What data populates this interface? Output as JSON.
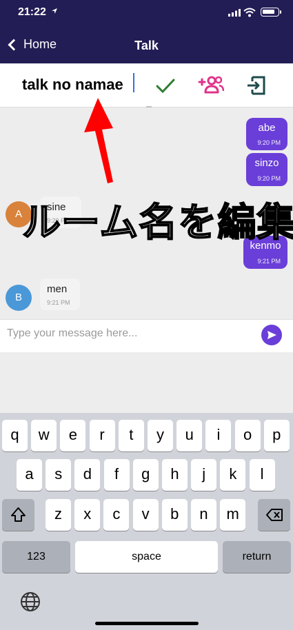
{
  "status_bar": {
    "time": "21:22"
  },
  "nav": {
    "back_label": "Home",
    "title": "Talk"
  },
  "room": {
    "name": "talk no namae"
  },
  "overlay": {
    "annotation": "ルーム名を編集"
  },
  "messages": [
    {
      "direction": "out",
      "text": "abe",
      "time": "9:20 PM"
    },
    {
      "direction": "out",
      "text": "sinzo",
      "time": "9:20 PM"
    },
    {
      "direction": "in",
      "avatar": "A",
      "text": "sine",
      "time": "9:20 PM",
      "avatar_color": "#d9823b"
    },
    {
      "direction": "out",
      "text": "kenmo",
      "time": "9:21 PM"
    },
    {
      "direction": "in",
      "avatar": "B",
      "text": "men",
      "time": "9:21 PM",
      "avatar_color": "#4a98d8"
    }
  ],
  "composer": {
    "placeholder": "Type your message here..."
  },
  "keyboard": {
    "row1": [
      "q",
      "w",
      "e",
      "r",
      "t",
      "y",
      "u",
      "i",
      "o",
      "p"
    ],
    "row2": [
      "a",
      "s",
      "d",
      "f",
      "g",
      "h",
      "j",
      "k",
      "l"
    ],
    "row3": [
      "z",
      "x",
      "c",
      "v",
      "b",
      "n",
      "m"
    ],
    "numbers_label": "123",
    "space_label": "space",
    "return_label": "return"
  },
  "colors": {
    "header": "#231d55",
    "accent": "#6a3ed8",
    "check": "#2e7d32",
    "add_users": "#e0338a",
    "exit": "#1f4a4a"
  },
  "icons": [
    "location-arrow-icon",
    "signal-icon",
    "wifi-icon",
    "battery-icon",
    "check-icon",
    "add-users-icon",
    "exit-room-icon",
    "send-icon",
    "shift-icon",
    "backspace-icon",
    "globe-icon"
  ]
}
